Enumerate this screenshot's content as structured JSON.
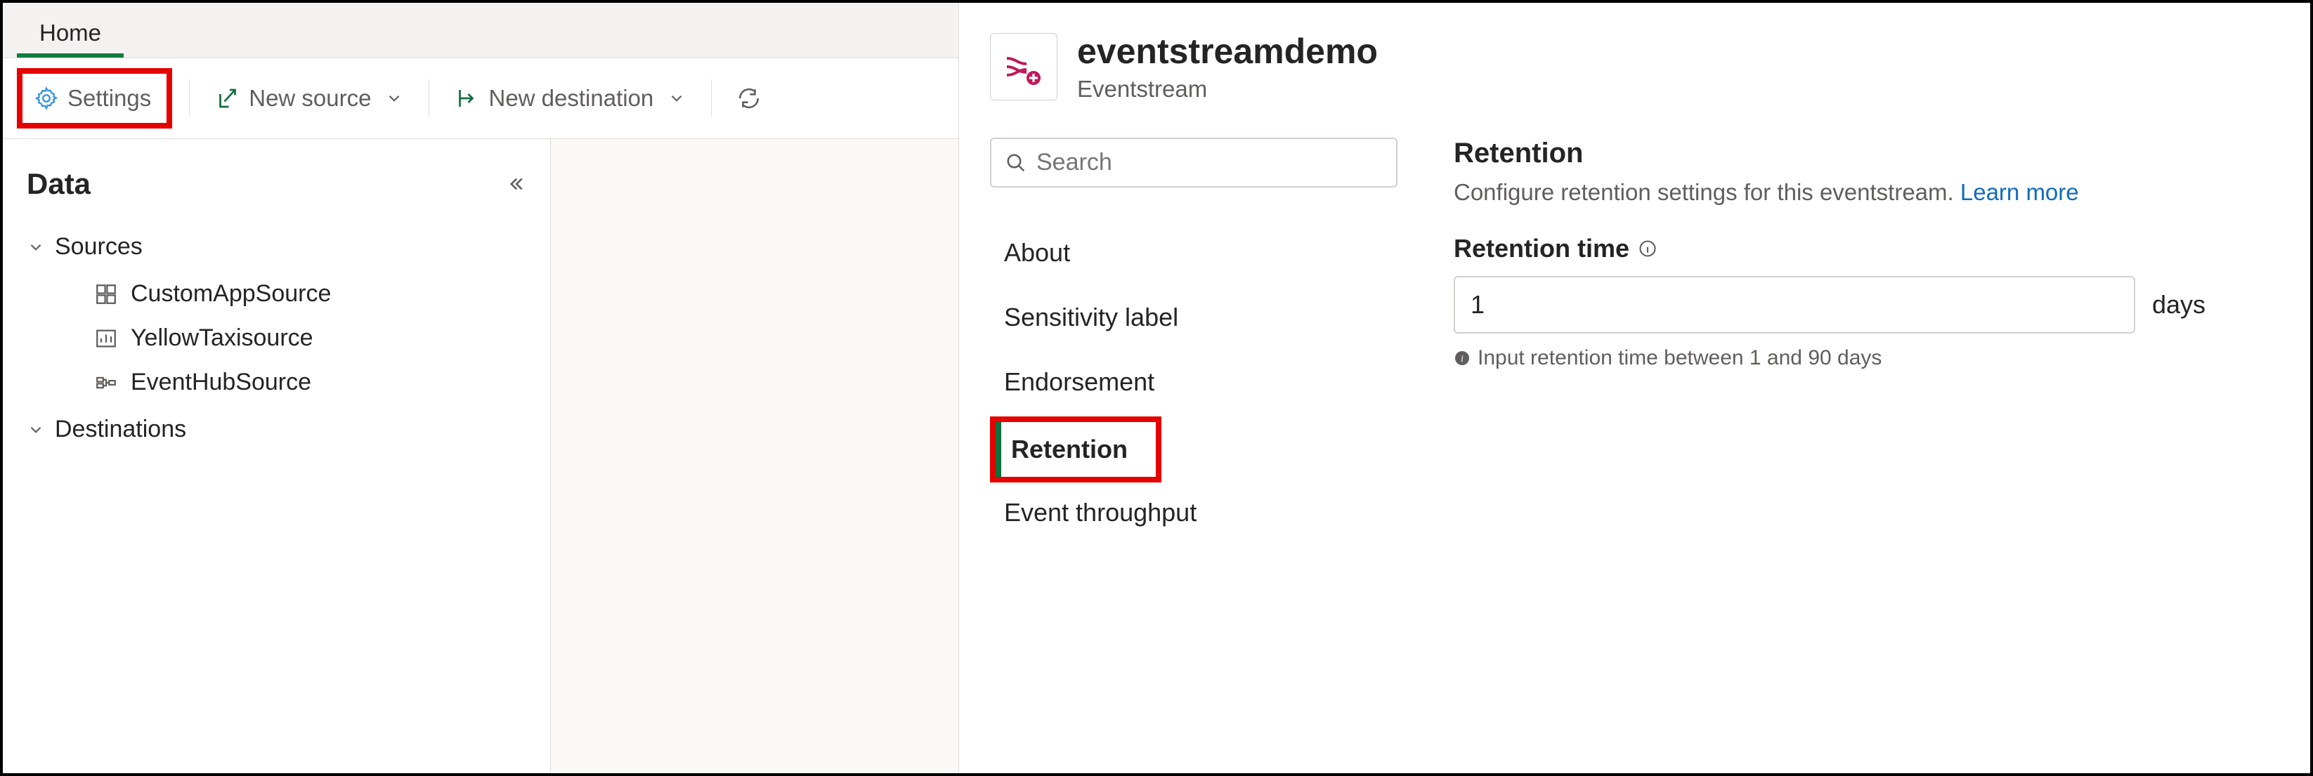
{
  "tabs": {
    "home": "Home"
  },
  "toolbar": {
    "settings": "Settings",
    "new_source": "New source",
    "new_destination": "New destination"
  },
  "data_panel": {
    "title": "Data",
    "sources_label": "Sources",
    "destinations_label": "Destinations",
    "sources": [
      {
        "name": "CustomAppSource"
      },
      {
        "name": "YellowTaxisource"
      },
      {
        "name": "EventHubSource"
      }
    ]
  },
  "flyout": {
    "title": "eventstreamdemo",
    "subtitle": "Eventstream",
    "search_placeholder": "Search",
    "nav": {
      "about": "About",
      "sensitivity": "Sensitivity label",
      "endorsement": "Endorsement",
      "retention": "Retention",
      "throughput": "Event throughput"
    },
    "retention_section": {
      "title": "Retention",
      "desc": "Configure retention settings for this eventstream.",
      "learn_more": "Learn more",
      "field_label": "Retention time",
      "value": "1",
      "unit": "days",
      "hint": "Input retention time between 1 and 90 days"
    }
  }
}
